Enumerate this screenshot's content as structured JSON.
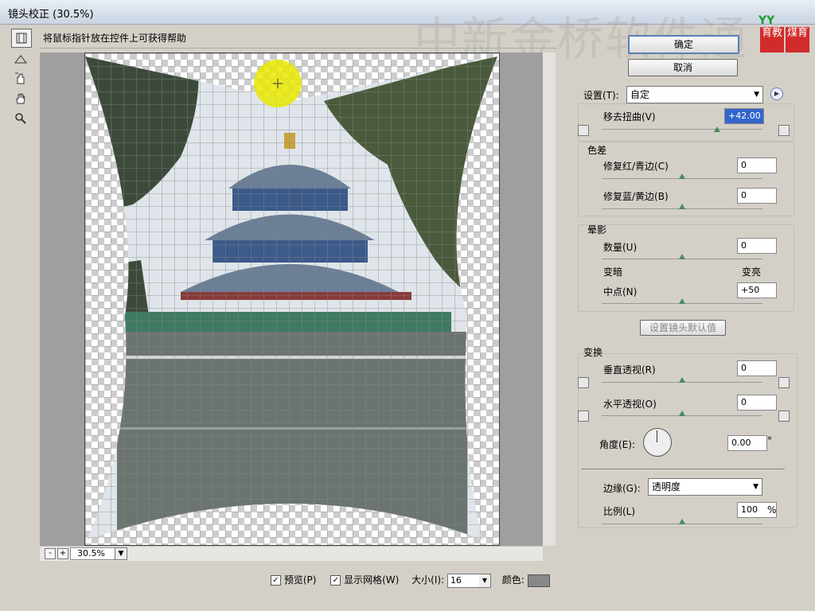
{
  "window": {
    "title": "镜头校正 (30.5%)"
  },
  "watermark": "中新金桥软件通",
  "logo": {
    "top": "YY",
    "left_text": "育教",
    "right_text": "煤育"
  },
  "hint": "将鼠标指针放在控件上可获得帮助",
  "buttons": {
    "ok": "确定",
    "cancel": "取消",
    "reset": "设置镜头默认值"
  },
  "settings": {
    "label": "设置(T):",
    "value": "自定"
  },
  "distortion": {
    "label": "移去扭曲(V)",
    "value": "+42.00",
    "level": 0.71
  },
  "chromatic": {
    "title": "色差",
    "red_cyan": {
      "label": "修复红/青边(C)",
      "value": "0",
      "level": 0.5
    },
    "blue_yellow": {
      "label": "修复蓝/黄边(B)",
      "value": "0",
      "level": 0.5
    }
  },
  "vignette": {
    "title": "晕影",
    "amount": {
      "label": "数量(U)",
      "value": "0",
      "level": 0.5
    },
    "darken": "变暗",
    "lighten": "变亮",
    "midpoint": {
      "label": "中点(N)",
      "value": "+50",
      "level": 0.5
    }
  },
  "transform": {
    "title": "变换",
    "vertical": {
      "label": "垂直透视(R)",
      "value": "0",
      "level": 0.5
    },
    "horizontal": {
      "label": "水平透视(O)",
      "value": "0",
      "level": 0.5
    },
    "angle": {
      "label": "角度(E):",
      "value": "0.00",
      "unit": "°"
    }
  },
  "edge": {
    "label": "边缘(G):",
    "value": "透明度"
  },
  "scale": {
    "label": "比例(L)",
    "value": "100",
    "unit": "%",
    "level": 0.5
  },
  "zoom": {
    "value": "30.5%",
    "minus": "-",
    "plus": "+"
  },
  "bottom": {
    "preview": "预览(P)",
    "grid": "显示网格(W)",
    "size_label": "大小(I):",
    "size_value": "16",
    "color_label": "颜色:"
  },
  "icons": [
    "constrain-tool-icon",
    "straighten-icon",
    "move-grid-icon",
    "hand-icon",
    "zoom-icon",
    "settings-menu-icon"
  ],
  "colors": {
    "accent": "#5a7fb8",
    "grid_color": "#888888",
    "sun": "#e8e800"
  }
}
